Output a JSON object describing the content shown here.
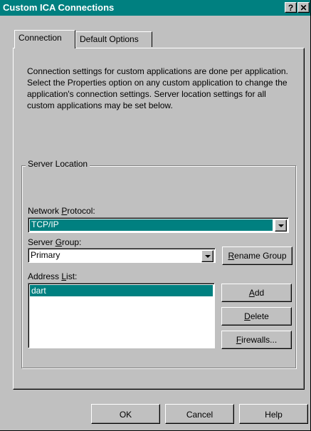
{
  "window": {
    "title": "Custom ICA Connections",
    "help_glyph": "?",
    "close_glyph": "✕"
  },
  "tabs": [
    {
      "label": "Connection",
      "active": true
    },
    {
      "label": "Default Options",
      "active": false
    }
  ],
  "description": "Connection settings for custom applications are done per application.  Select the Properties option on any custom application to change the application's connection settings. Server location settings for all custom applications may be set below.",
  "server_location": {
    "group_label": "Server Location",
    "network_protocol": {
      "label_pre": "Network ",
      "label_mn": "P",
      "label_post": "rotocol:",
      "value": "TCP/IP"
    },
    "server_group": {
      "label_pre": "Server ",
      "label_mn": "G",
      "label_post": "roup:",
      "value": "Primary"
    },
    "rename_group": {
      "mn": "R",
      "rest": "ename Group"
    },
    "address_list": {
      "label_pre": "Address ",
      "label_mn": "L",
      "label_post": "ist:",
      "items": [
        "dart"
      ],
      "selected": "dart"
    },
    "add": {
      "mn": "A",
      "rest": "dd"
    },
    "delete": {
      "mn": "D",
      "rest": "elete"
    },
    "firewalls": {
      "mn": "F",
      "rest": "irewalls..."
    }
  },
  "footer": {
    "ok": "OK",
    "cancel": "Cancel",
    "help": "Help"
  },
  "colors": {
    "titlebar": "#008080",
    "selection": "#008080",
    "face": "#c0c0c0"
  }
}
